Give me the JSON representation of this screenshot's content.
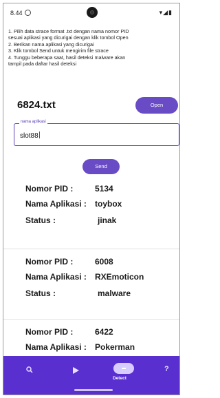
{
  "status_bar": {
    "time": "8.44",
    "indicators": "▾◢▮"
  },
  "instructions": [
    "1. Pilih data strace format .txt dengan nama nomor PID",
    "sesuai aplikasi yang dicurigai dengan klik tombol Open",
    "2. Berikan nama aplikasi yang dicurigai",
    "3. Klik tombol Send untuk mengirim file strace",
    "4. Tunggu beberapa saat, hasil deteksi malware akan",
    "tampil pada daftar hasil deteksi"
  ],
  "file": {
    "name": "6824.txt",
    "open_label": "Open"
  },
  "app_name_field": {
    "label": "nama aplikasi",
    "value": "slot88"
  },
  "send_label": "Send",
  "results": [
    {
      "pid_label": "Nomor PID :",
      "pid": "5134",
      "app_label": "Nama Aplikasi :",
      "app": "toybox",
      "status_label": "Status :",
      "status": "jinak"
    },
    {
      "pid_label": "Nomor PID :",
      "pid": "6008",
      "app_label": "Nama Aplikasi :",
      "app": "RXEmoticon",
      "status_label": "Status :",
      "status": "malware"
    },
    {
      "pid_label": "Nomor PID :",
      "pid": "6422",
      "app_label": "Nama Aplikasi :",
      "app": "Pokerman"
    }
  ],
  "bottom_nav": {
    "items": [
      {
        "icon": "search-icon"
      },
      {
        "icon": "send-icon"
      },
      {
        "icon": "detect-icon",
        "label": "Detect"
      },
      {
        "icon": "help-icon",
        "glyph": "?"
      }
    ]
  },
  "colors": {
    "accent": "#6a4bc6",
    "nav_background": "#5a2fd0"
  }
}
